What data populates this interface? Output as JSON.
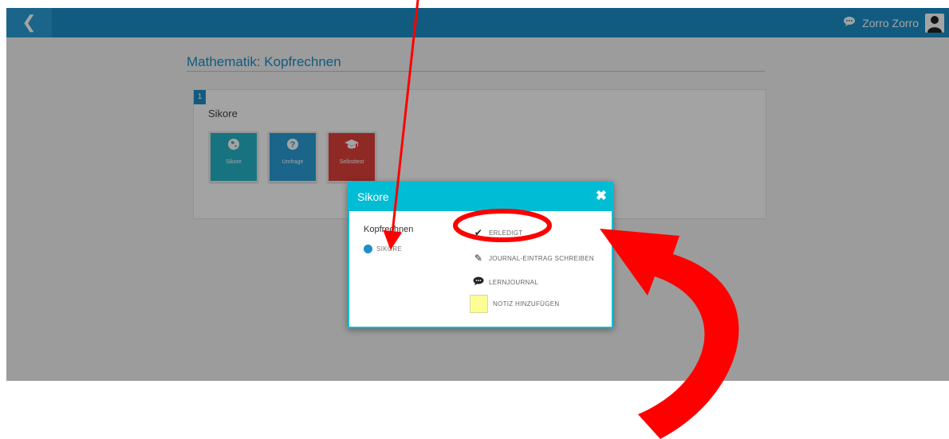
{
  "topbar": {
    "back_icon": "chevron-left-icon",
    "user_name": "Zorro Zorro",
    "chat_icon": "chat-bubble-icon",
    "avatar_icon": "user-icon"
  },
  "page": {
    "title": "Mathematik: Kopfrechnen",
    "card": {
      "number": "1",
      "title": "Sikore",
      "tiles": [
        {
          "label": "Sikore",
          "icon": "globe-icon",
          "color": "#26b5c9"
        },
        {
          "label": "Umfrage",
          "icon": "question-icon",
          "color": "#2a9fd6"
        },
        {
          "label": "Selbsttest",
          "icon": "graduation-cap-icon",
          "color": "#e0403a"
        }
      ]
    }
  },
  "modal": {
    "title": "Sikore",
    "close_icon": "close-icon",
    "left_title": "Kopfrechnen",
    "left_item": "SIKORE",
    "actions": [
      {
        "label": "ERLEDIGT",
        "icon": "check-icon"
      },
      {
        "label": "JOURNAL-EINTRAG SCHREIBEN",
        "icon": "pencil-icon"
      },
      {
        "label": "LERNJOURNAL",
        "icon": "comment-icon"
      },
      {
        "label": "NOTIZ HINZUFÜGEN",
        "icon": "note-swatch"
      }
    ]
  },
  "colors": {
    "topbar": "#1d8fc9",
    "modal_accent": "#00bcd4",
    "annotation": "#ff0000"
  }
}
